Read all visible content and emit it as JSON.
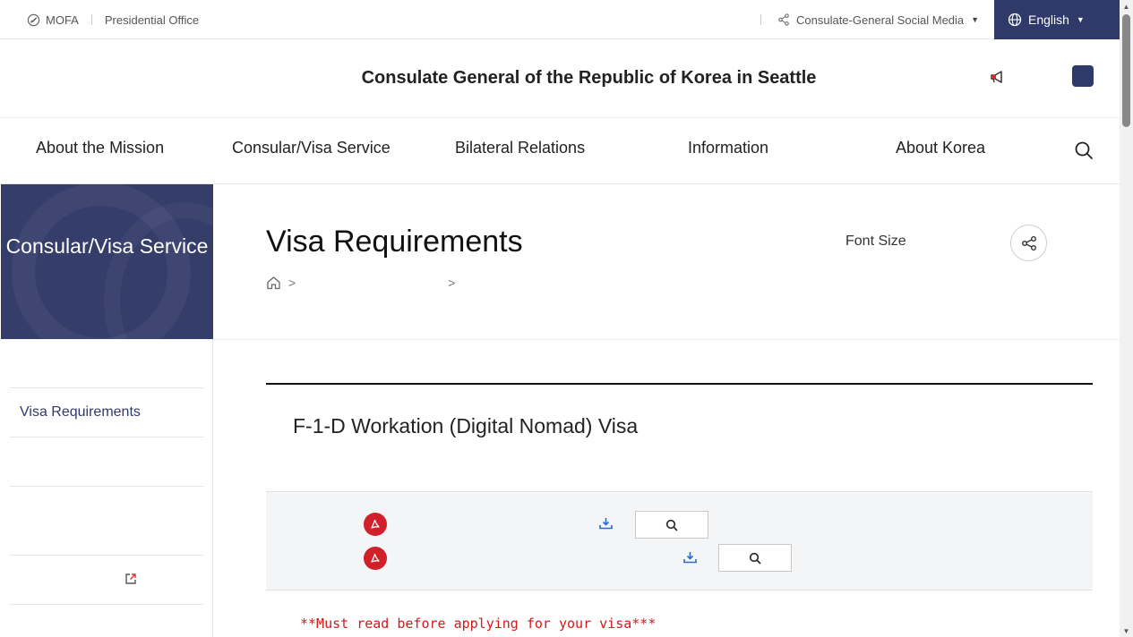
{
  "topbar": {
    "mofa_label": "MOFA",
    "office_label": "Presidential Office",
    "social_label": "Consulate-General Social Media",
    "language_label": "English"
  },
  "header": {
    "site_title": "Consulate General of the Republic of Korea in Seattle"
  },
  "nav": {
    "items": [
      "About the Mission",
      "Consular/Visa Service",
      "Bilateral Relations",
      "Information",
      "About Korea"
    ]
  },
  "sidebar": {
    "section_title": "Consular/Visa Service",
    "items": [
      {
        "label": "Visa Requirements",
        "active": true
      }
    ]
  },
  "content": {
    "page_title": "Visa Requirements",
    "font_size_label": "Font Size",
    "breadcrumb_sep": ">",
    "article_title": "F-1-D Workation (Digital Nomad) Visa",
    "warning": "**Must read before applying for your visa***"
  },
  "colors": {
    "brand_navy": "#2f3a6b",
    "sidebar_bg": "#353d6a",
    "pdf_red": "#d0202a",
    "download_blue": "#2b6cc4",
    "warning_red": "#d11a1a"
  },
  "icons": {
    "mofa": "circle-slash-icon",
    "social": "share-icon",
    "language": "globe-icon",
    "announcement": "megaphone-icon",
    "search": "search-icon",
    "home": "home-icon",
    "share": "share-icon",
    "pdf": "pdf-icon",
    "download": "download-icon",
    "preview": "magnifier-icon",
    "external": "external-link-icon"
  }
}
